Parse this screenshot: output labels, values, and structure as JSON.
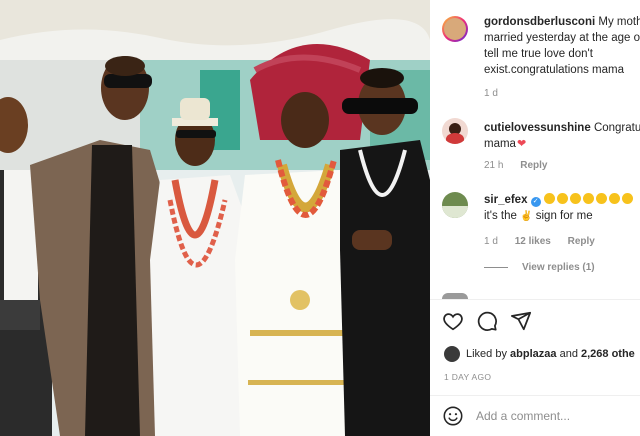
{
  "post": {
    "author": "gordonsdberlusconi",
    "caption_lines": [
      "My mothe",
      "married yesterday at the age o",
      "tell me true love don't",
      "exist.congratulations mama"
    ],
    "caption_time": "1 d"
  },
  "comments": [
    {
      "username": "cutielovessunshine",
      "text_lines": [
        "Congratula",
        "mama"
      ],
      "time": "21 h",
      "reply_label": "Reply"
    },
    {
      "username": "sir_efex",
      "verified": true,
      "emoji_count": 7,
      "text_line2_prefix": "it's the",
      "text_line2_suffix": "sign for me",
      "time": "1 d",
      "likes": "12 likes",
      "reply_label": "Reply",
      "view_replies": "View replies (1)"
    }
  ],
  "likes": {
    "prefix": "Liked by",
    "user": "abplazaa",
    "and": "and",
    "count": "2,268 othe"
  },
  "time_ago": "1 DAY AGO",
  "add_comment_placeholder": "Add a comment...",
  "icons": {
    "like": "heart-icon",
    "comment": "comment-bubble-icon",
    "share": "paper-plane-icon",
    "emoji": "smiley-icon",
    "verified": "verified-badge-icon"
  },
  "colors": {
    "verified": "#3897f0",
    "heart_emoji": "#ed4956",
    "muted": "#8e8e8e"
  }
}
